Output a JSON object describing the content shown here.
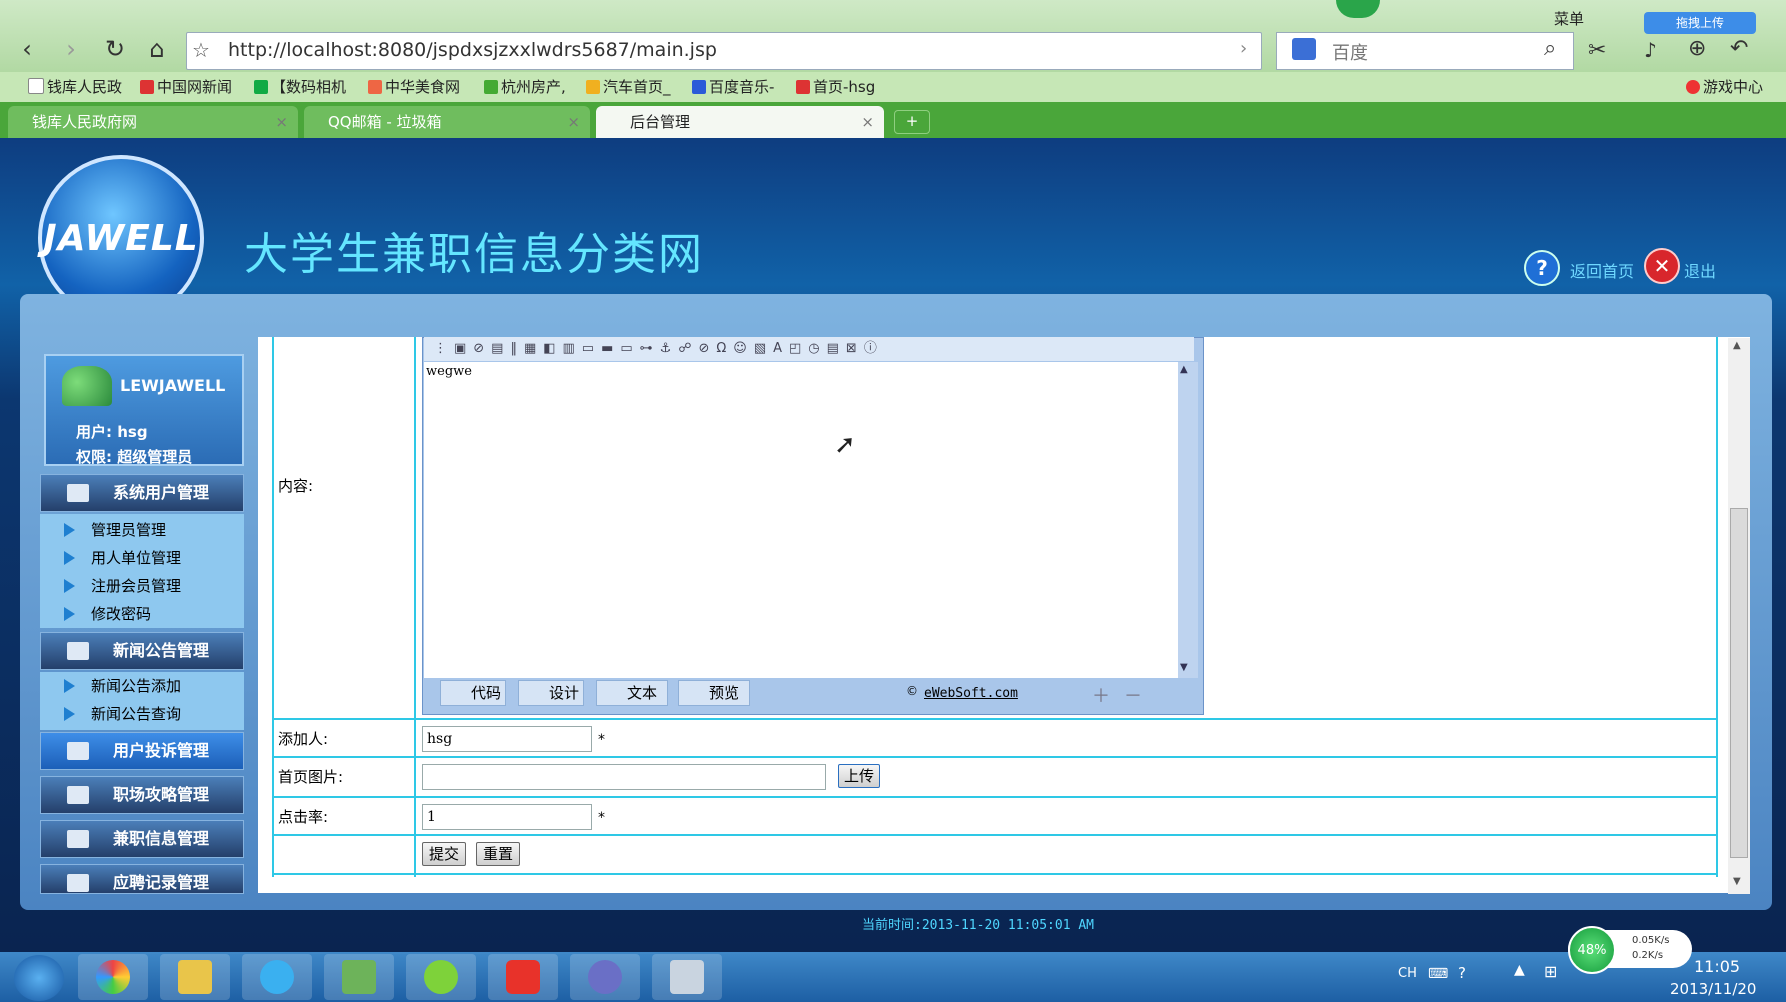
{
  "browser": {
    "url": "http://localhost:8080/jspdxsjzxxlwdrs5687/main.jsp",
    "search_placeholder": "百度",
    "menu_label": "菜单",
    "upload_label": "拖拽上传",
    "game_center": "游戏中心",
    "bookmarks": [
      "钱库人民政",
      "中国网新闻",
      "【数码相机",
      "中华美食网",
      "杭州房产,",
      "汽车首页_",
      "百度音乐-",
      "首页-hsg"
    ],
    "tabs": [
      {
        "label": "钱库人民政府网"
      },
      {
        "label": "QQ邮箱 - 垃圾箱"
      },
      {
        "label": "后台管理"
      }
    ],
    "new_tab": "+"
  },
  "header": {
    "logo_text": "JAWELL",
    "site_title": "大学生兼职信息分类网",
    "home_link": "返回首页",
    "logout_link": "退出"
  },
  "sidebar": {
    "brand": "LEWJAWELL",
    "user": "用户: hsg",
    "role": "权限: 超级管理员",
    "sections": [
      {
        "label": "系统用户管理",
        "items": [
          "管理员管理",
          "用人单位管理",
          "注册会员管理",
          "修改密码"
        ]
      },
      {
        "label": "新闻公告管理",
        "items": [
          "新闻公告添加",
          "新闻公告查询"
        ]
      },
      {
        "label": "用户投诉管理",
        "items": []
      },
      {
        "label": "职场攻略管理",
        "items": []
      },
      {
        "label": "兼职信息管理",
        "items": []
      },
      {
        "label": "应聘记录管理",
        "items": []
      }
    ]
  },
  "form": {
    "content_label": "内容:",
    "editor_text": "wegwe",
    "editor_tabs": [
      "代码",
      "设计",
      "文本",
      "预览"
    ],
    "editor_brand": "eWebSoft.com",
    "adder_label": "添加人:",
    "adder_value": "hsg",
    "image_label": "首页图片:",
    "image_value": "",
    "upload_button": "上传",
    "clicks_label": "点击率:",
    "clicks_value": "1",
    "required_mark": "*",
    "submit_button": "提交",
    "reset_button": "重置"
  },
  "footer": {
    "time": "当前时间:2013-11-20 11:05:01 AM"
  },
  "taskbar": {
    "lang": "CH",
    "battery": "48%",
    "up_speed": "0.05K/s",
    "down_speed": "0.2K/s",
    "clock_time": "11:05",
    "clock_date": "2013/11/20"
  }
}
